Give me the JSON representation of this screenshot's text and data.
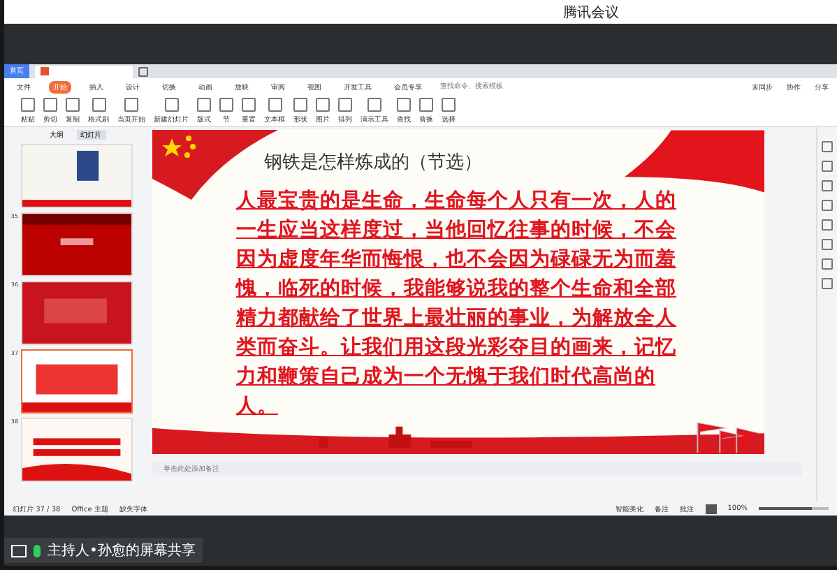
{
  "meeting": {
    "title": "腾讯会议",
    "share_label": "主持人•孙愈的屏幕共享"
  },
  "wps": {
    "home_tab": "首页",
    "menu": [
      {
        "label": "文件",
        "selected": false
      },
      {
        "label": "开始",
        "selected": true
      },
      {
        "label": "插入",
        "selected": false
      },
      {
        "label": "设计",
        "selected": false
      },
      {
        "label": "切换",
        "selected": false
      },
      {
        "label": "动画",
        "selected": false
      },
      {
        "label": "放映",
        "selected": false
      },
      {
        "label": "审阅",
        "selected": false
      },
      {
        "label": "视图",
        "selected": false
      },
      {
        "label": "开发工具",
        "selected": false
      },
      {
        "label": "会员专享",
        "selected": false
      }
    ],
    "search": {
      "placeholder": "查找命令、搜索模板"
    },
    "right_actions": [
      "未同步",
      "协作",
      "分享"
    ],
    "ribbon": [
      "粘贴",
      "剪切",
      "复制",
      "格式刷",
      "当页开始",
      "新建幻灯片",
      "版式",
      "节",
      "重置",
      "文本框",
      "形状",
      "图片",
      "排列",
      "演示工具",
      "查找",
      "替换",
      "选择"
    ],
    "sidebar": {
      "tabs": [
        {
          "label": "大纲",
          "selected": false
        },
        {
          "label": "幻灯片",
          "selected": true
        }
      ],
      "thumbnails": [
        {
          "kind": "document",
          "selected": false
        },
        {
          "number": "35",
          "kind": "curtain",
          "selected": false
        },
        {
          "number": "36",
          "kind": "banner",
          "selected": false
        },
        {
          "number": "37",
          "kind": "text",
          "selected": true
        },
        {
          "number": "38",
          "kind": "ribbon",
          "selected": false
        }
      ]
    },
    "slide": {
      "title": "钢铁是怎样炼成的（节选）",
      "body": "人最宝贵的是生命，生命每个人只有一次，人的一生应当这样度过，当他回忆往事的时候，不会因为虚度年华而悔恨，也不会因为碌碌无为而羞愧，临死的时候，我能够说我的整个生命和全部精力都献给了世界上最壮丽的事业，为解放全人类而奋斗。让我们用这段光彩夺目的画来，记忆力和鞭策自己成为一个无愧于我们时代高尚的人。"
    },
    "notes": {
      "placeholder": "单击此处添加备注"
    },
    "status": {
      "slide_count": "幻灯片 37 / 38",
      "theme": "Office 主题",
      "fonts": "缺失字体",
      "beautify": "智能美化",
      "notes": "备注",
      "comments": "批注",
      "zoom": "100%",
      "zoom_level": {
        "level": 0.75
      }
    }
  }
}
